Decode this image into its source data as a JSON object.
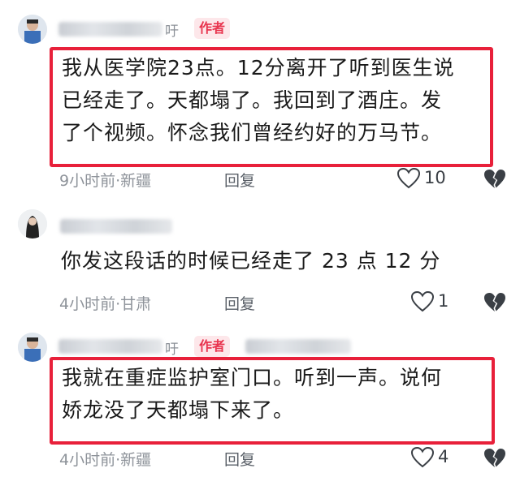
{
  "comments": [
    {
      "name_tail": "吁",
      "badge": "作者",
      "text_lines": [
        "我从医学院23点。12分离开了听到医生说",
        "已经走了。天都塌了。我回到了酒庄。发",
        "了个视频。怀念我们曾经约好的万马节。"
      ],
      "meta": "9小时前·新疆",
      "reply_label": "回复",
      "likes": "10"
    },
    {
      "text_lines": [
        "你发这段话的时候已经走了  23 点 12 分"
      ],
      "meta": "4小时前·甘肃",
      "reply_label": "回复",
      "likes": "1"
    },
    {
      "name_tail": "吁",
      "badge": "作者",
      "text_lines": [
        "我就在重症监护室门口。听到一声。说何",
        "娇龙没了天都塌下来了。"
      ],
      "meta": "4小时前·新疆",
      "reply_label": "回复",
      "likes": "4"
    }
  ],
  "colors": {
    "highlight_border": "#e8203a",
    "badge_bg": "#fde7ea",
    "badge_text": "#e8344e",
    "meta_text": "#8e939a"
  },
  "icons": [
    "heart-outline-icon",
    "broken-heart-icon"
  ]
}
